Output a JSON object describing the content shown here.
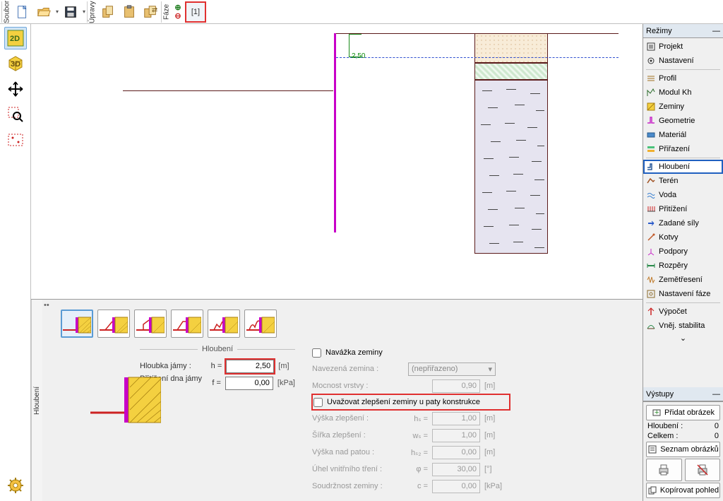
{
  "toolbar": {
    "vtab_file": "Soubor",
    "vtab_edit": "Úpravy",
    "vtab_phase": "Fáze",
    "phase_btn": "[1]"
  },
  "left_tools": {
    "d2": "2D",
    "d3": "3D"
  },
  "canvas": {
    "dim_label": "2,50"
  },
  "bottom": {
    "tab_label": "Hloubení",
    "group_title": "Hloubení",
    "row_depth_label": "Hloubka jámy :",
    "row_depth_sym": "h =",
    "row_depth_val": "2,50",
    "row_depth_unit": "[m]",
    "row_surcharge_label": "Přitížení dna jámy :",
    "row_surcharge_sym": "f =",
    "row_surcharge_val": "0,00",
    "row_surcharge_unit": "[kPa]",
    "chk_fill": "Navážka zeminy",
    "fill_soil_label": "Navezená zemina :",
    "fill_soil_val": "(nepřiřazeno)",
    "fill_thick_label": "Mocnost vrstvy :",
    "fill_thick_val": "0,90",
    "fill_thick_unit": "[m]",
    "chk_improve": "Uvažovat zlepšení zeminy u paty konstrukce",
    "imp_h_label": "Výška zlepšení :",
    "imp_h_sym": "hₛ =",
    "imp_h_val": "1,00",
    "imp_h_unit": "[m]",
    "imp_w_label": "Šířka zlepšení :",
    "imp_w_sym": "wₛ =",
    "imp_w_val": "1,00",
    "imp_w_unit": "[m]",
    "imp_h2_label": "Výška nad patou :",
    "imp_h2_sym": "hₛ₂ =",
    "imp_h2_val": "0,00",
    "imp_h2_unit": "[m]",
    "imp_phi_label": "Úhel vnitřního tření :",
    "imp_phi_sym": "φ =",
    "imp_phi_val": "30,00",
    "imp_phi_unit": "[°]",
    "imp_c_label": "Soudržnost zeminy :",
    "imp_c_sym": "c =",
    "imp_c_val": "0,00",
    "imp_c_unit": "[kPa]"
  },
  "sidebar": {
    "header": "Režimy",
    "items": [
      "Projekt",
      "Nastavení",
      "Profil",
      "Modul Kh",
      "Zeminy",
      "Geometrie",
      "Materiál",
      "Přiřazení",
      "Hloubení",
      "Terén",
      "Voda",
      "Přitížení",
      "Zadané síly",
      "Kotvy",
      "Podpory",
      "Rozpěry",
      "Zemětřesení",
      "Nastavení fáze",
      "Výpočet",
      "Vněj. stabilita"
    ],
    "footer": {
      "outputs_header": "Výstupy",
      "add_image": "Přidat obrázek",
      "stat_a_label": "Hloubení :",
      "stat_a_val": "0",
      "stat_b_label": "Celkem :",
      "stat_b_val": "0",
      "image_list": "Seznam obrázků",
      "copy_view": "Kopírovat pohled"
    }
  }
}
